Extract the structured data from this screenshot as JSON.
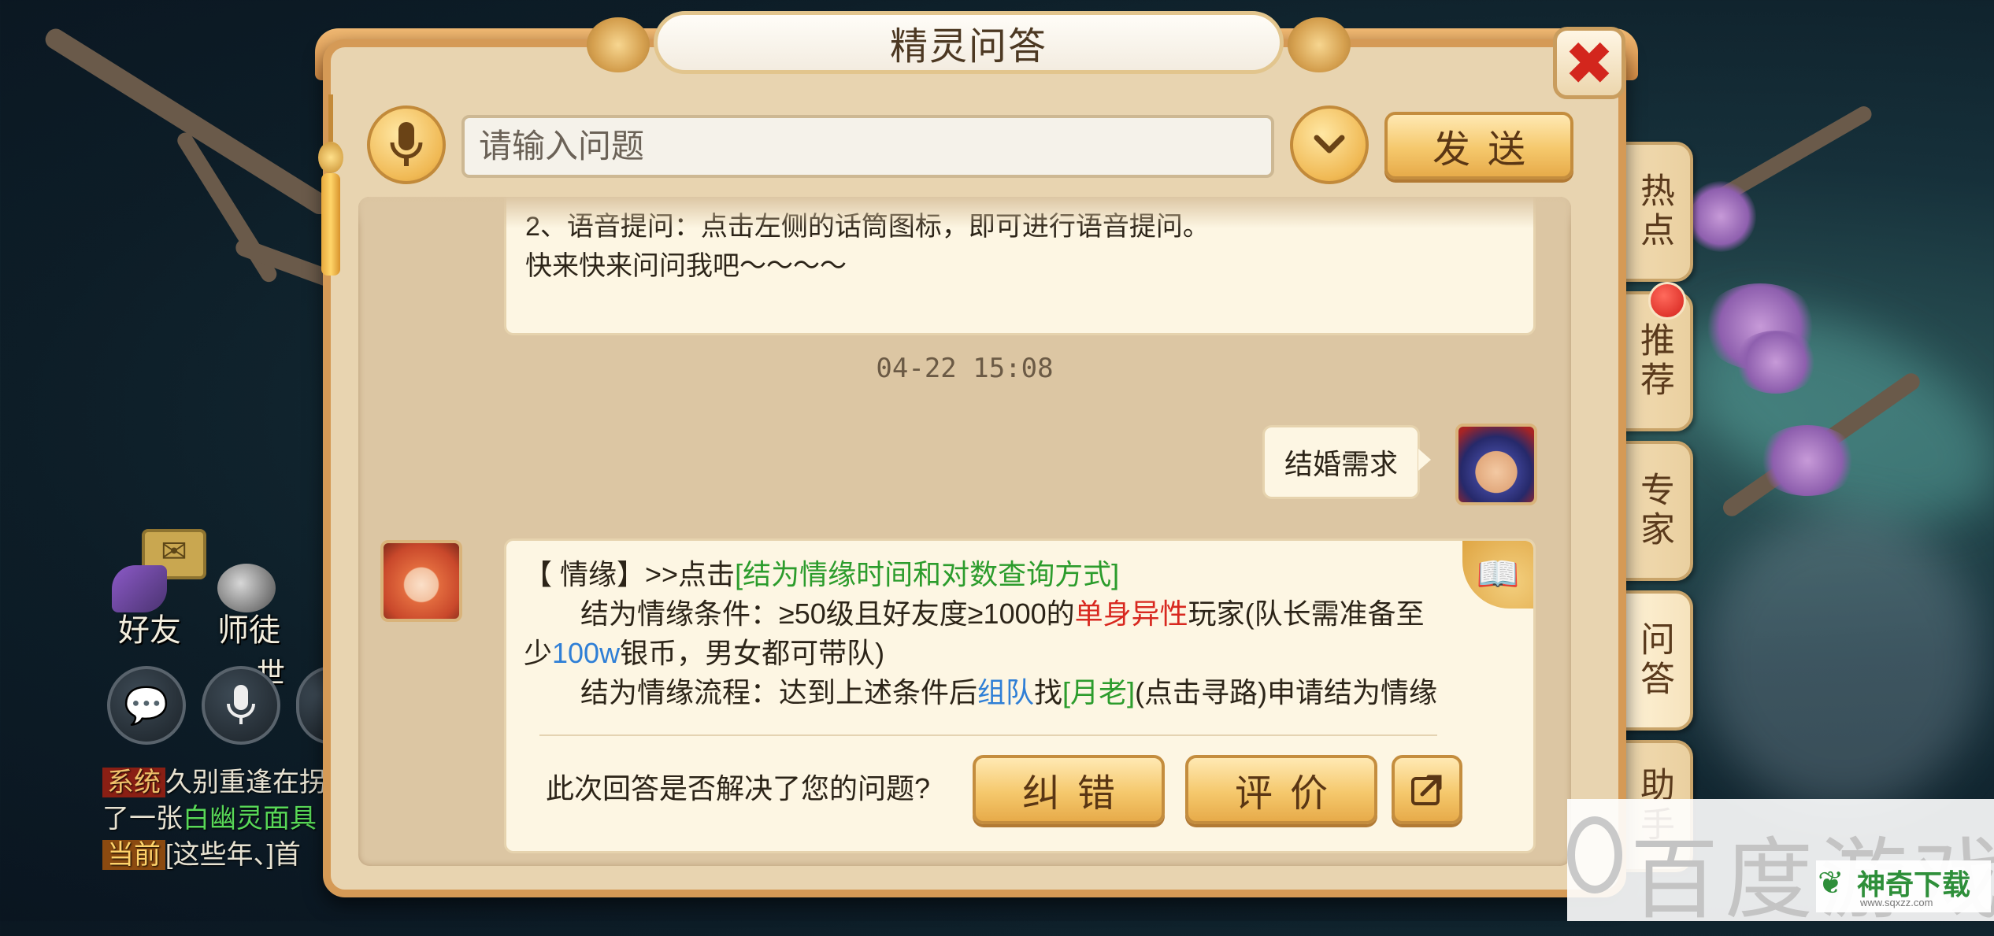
{
  "dialog": {
    "title": "精灵问答",
    "close_glyph": "✖",
    "search_placeholder": "请输入问题",
    "send_label": "发送"
  },
  "tabs": [
    {
      "label": "热点",
      "badge": false
    },
    {
      "label": "推荐",
      "badge": true
    },
    {
      "label": "专家",
      "badge": false
    },
    {
      "label": "问答",
      "badge": false
    },
    {
      "label": "助手",
      "badge": false
    }
  ],
  "messages": {
    "intro_line1": "2、语音提问：点击左侧的话筒图标，即可进行语音提问。",
    "intro_line2": "快来快来问问我吧～～～～",
    "timestamp": "04-22 15:08",
    "user_question": "结婚需求",
    "answer": {
      "p1_prefix": "【 情缘】>>点击",
      "p1_link": "[结为情缘时间和对数查询方式]",
      "p2_a": "结为情缘条件：≥50级且好友度≥1000的",
      "p2_red": "单身异性",
      "p2_b": "玩家(队长需准备至",
      "p3_a": "少",
      "p3_blue": "100w",
      "p3_b": "银币，男女都可带队)",
      "p4_a": "结为情缘流程：达到上述条件后",
      "p4_blue": "组队",
      "p4_b": "找",
      "p4_green": "[月老]",
      "p4_c": "(点击寻路)申请结为情缘"
    },
    "feedback_question": "此次回答是否解决了您的问题?",
    "correct_label": "纠错",
    "rate_label": "评价"
  },
  "game": {
    "friends_label": "好友",
    "master_label": "师徒",
    "world_label": "世",
    "chat": [
      {
        "tag": "系统",
        "text": "久别重逢在拐"
      },
      {
        "tag": "",
        "text_a": "了一张",
        "text_green": "白幽灵面具"
      },
      {
        "tag": "当前",
        "text": "[这些年、]首"
      }
    ]
  },
  "watermark": {
    "brand": "百度游戏",
    "site": "神奇下载",
    "url": "www.sqxzz.com"
  },
  "colors": {
    "frame": "#d59a56",
    "paper": "#e8d4b0",
    "gold_button": "#f5c86c",
    "link_green": "#2c9c2c",
    "highlight_red": "#d8281f",
    "highlight_blue": "#2f7fd6",
    "close_red": "#d3261d"
  }
}
